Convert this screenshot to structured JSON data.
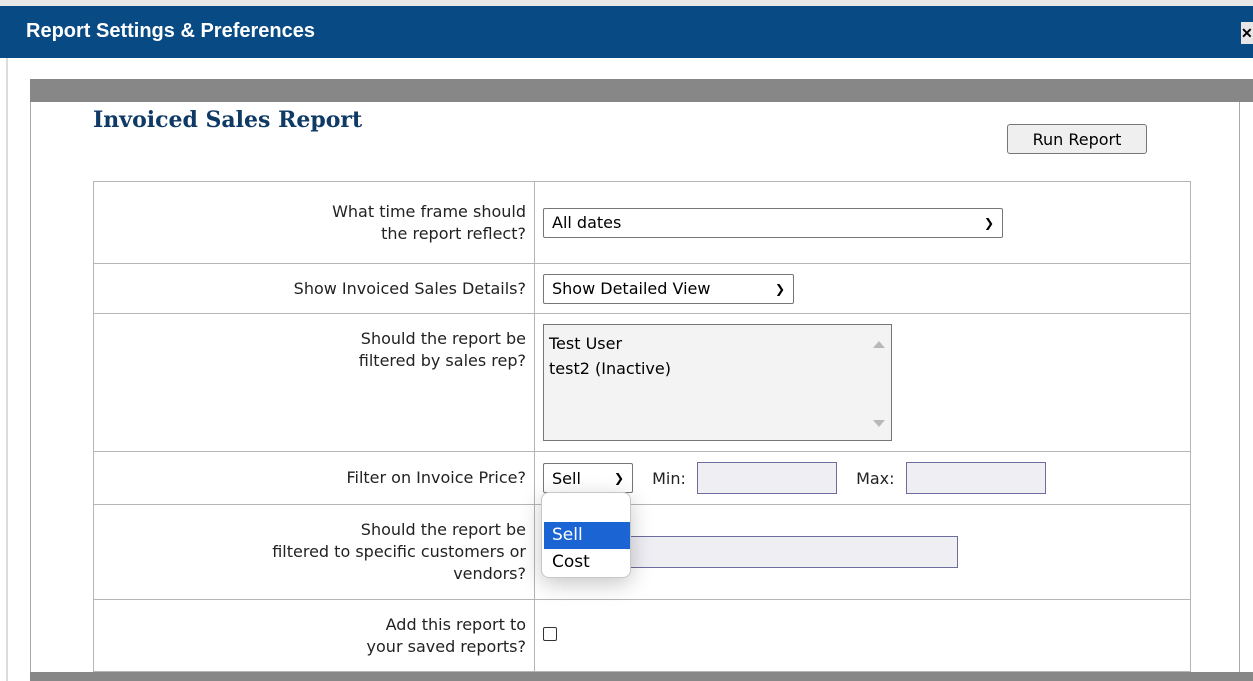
{
  "window": {
    "title": "Report Settings & Preferences",
    "close_glyph": "✕"
  },
  "report": {
    "title": "Invoiced Sales Report",
    "run_button_label": "Run Report"
  },
  "rows": {
    "time_frame": {
      "label_line1": "What time frame should",
      "label_line2": "the report reflect?",
      "selected": "All dates"
    },
    "details": {
      "label": "Show Invoiced Sales Details?",
      "selected": "Show Detailed View"
    },
    "sales_rep": {
      "label_line1": "Should the report be",
      "label_line2": "filtered by sales rep?",
      "options": [
        "Test User",
        "test2 (Inactive)"
      ]
    },
    "invoice_price": {
      "label": "Filter on Invoice Price?",
      "selected": "Sell",
      "min_label": "Min:",
      "max_label": "Max:",
      "min_value": "",
      "max_value": ""
    },
    "customers": {
      "label_line1": "Should the report be",
      "label_line2": "filtered to specific customers or",
      "label_line3": "vendors?",
      "value": ""
    },
    "saved": {
      "label_line1": "Add this report to",
      "label_line2": "your saved reports?",
      "checked": false
    }
  },
  "dropdown_open": {
    "options": [
      "Sell",
      "Cost"
    ],
    "highlighted": "Sell"
  },
  "colors": {
    "titlebar": "#084a83",
    "report_title": "#0f3a66",
    "dropdown_highlight": "#1b64d4",
    "gray_bar": "#878787"
  },
  "icons": {
    "chevron": "chevron-down-icon",
    "close": "close-icon"
  }
}
